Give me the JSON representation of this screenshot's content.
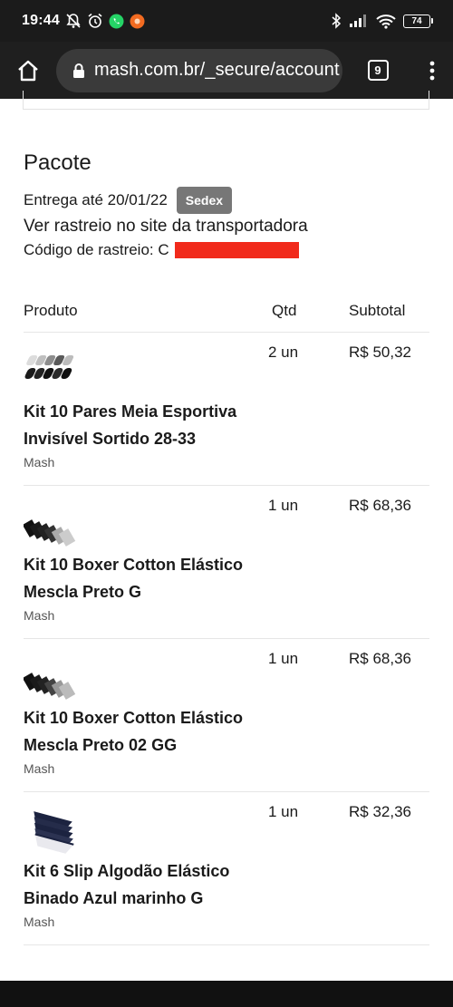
{
  "status_bar": {
    "time": "19:44",
    "battery": "74",
    "icons": [
      "mute-icon",
      "alarm-icon",
      "whatsapp-icon",
      "app-notification-icon",
      "bluetooth-icon",
      "signal-icon",
      "wifi-icon"
    ]
  },
  "browser": {
    "url": "mash.com.br/_secure/account",
    "tab_count": "9"
  },
  "package": {
    "title": "Pacote",
    "delivery": "Entrega até 20/01/22",
    "carrier": "Sedex",
    "tracking_link": "Ver rastreio no site da transportadora",
    "tracking_code_label": "Código de rastreio: C"
  },
  "table": {
    "headers": {
      "product": "Produto",
      "qty": "Qtd",
      "subtotal": "Subtotal"
    },
    "items": [
      {
        "name": "Kit 10 Pares Meia Esportiva Invisível Sortido 28-33",
        "brand": "Mash",
        "qty": "2 un",
        "subtotal": "R$ 50,32"
      },
      {
        "name": "Kit 10 Boxer Cotton Elástico Mescla Preto G",
        "brand": "Mash",
        "qty": "1 un",
        "subtotal": "R$ 68,36"
      },
      {
        "name": "Kit 10 Boxer Cotton Elástico Mescla Preto 02 GG",
        "brand": "Mash",
        "qty": "1 un",
        "subtotal": "R$ 68,36"
      },
      {
        "name": "Kit 6 Slip Algodão Elástico Binado Azul marinho G",
        "brand": "Mash",
        "qty": "1 un",
        "subtotal": "R$ 32,36"
      }
    ]
  },
  "colors": {
    "status_bar_bg": "#1b1b1b",
    "browser_bar_bg": "#1f1f1f",
    "url_box_bg": "#3a3a3a",
    "carrier_badge": "#777777",
    "redaction": "#f12a1b"
  }
}
